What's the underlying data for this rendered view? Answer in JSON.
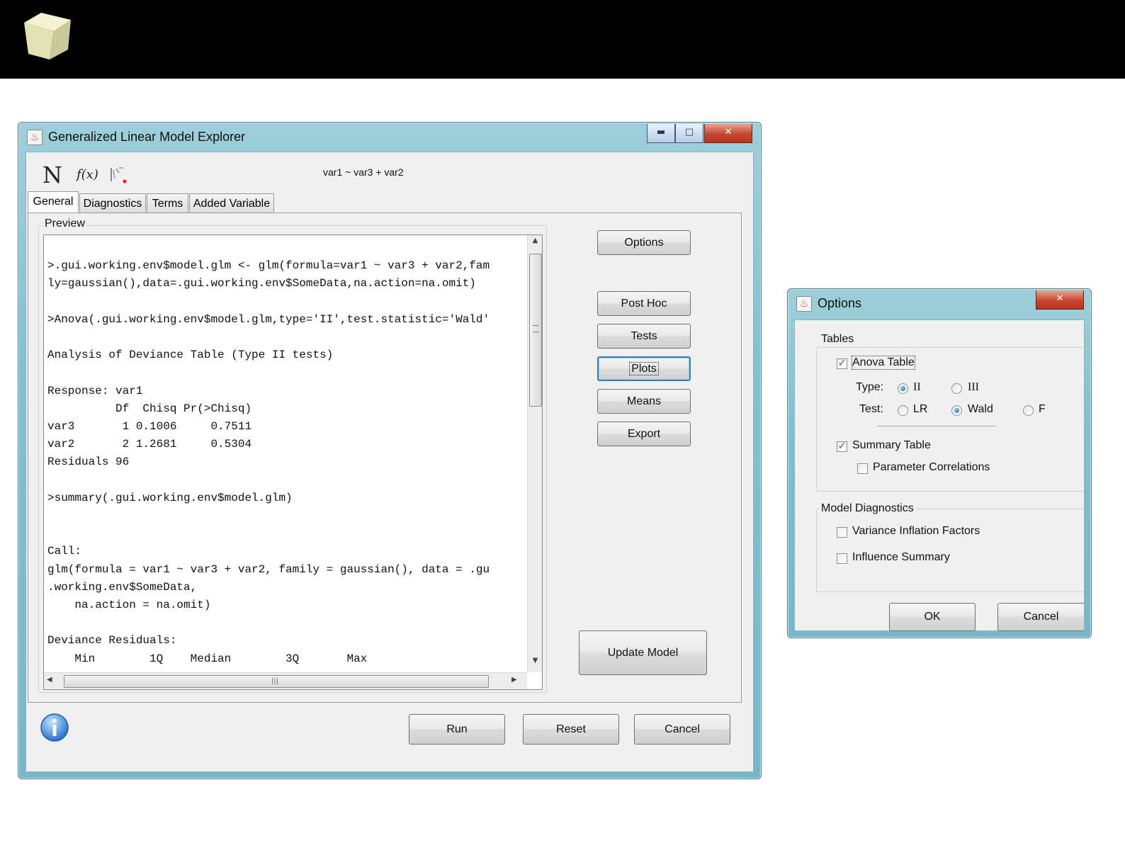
{
  "glm_window": {
    "title": "Generalized Linear Model Explorer",
    "toolbar": {
      "normal_icon": "N",
      "function_icon": "f(x)",
      "formula": "var1 ~ var3 + var2"
    },
    "tabs": [
      "General",
      "Diagnostics",
      "Terms",
      "Added Variable"
    ],
    "preview_label": "Preview",
    "preview_lines": [
      "",
      ">.gui.working.env$model.glm <- glm(formula=var1 ~ var3 + var2,fam",
      "ly=gaussian(),data=.gui.working.env$SomeData,na.action=na.omit)",
      "",
      ">Anova(.gui.working.env$model.glm,type='II',test.statistic='Wald'",
      "",
      "Analysis of Deviance Table (Type II tests)",
      "",
      "Response: var1",
      "          Df  Chisq Pr(>Chisq)",
      "var3       1 0.1006     0.7511",
      "var2       2 1.2681     0.5304",
      "Residuals 96",
      "",
      ">summary(.gui.working.env$model.glm)",
      "",
      "",
      "Call:",
      "glm(formula = var1 ~ var3 + var2, family = gaussian(), data = .gu",
      ".working.env$SomeData,",
      "    na.action = na.omit)",
      "",
      "Deviance Residuals:",
      "    Min        1Q    Median        3Q       Max"
    ],
    "side_buttons": {
      "options": "Options",
      "post_hoc": "Post Hoc",
      "tests": "Tests",
      "plots": "Plots",
      "means": "Means",
      "export": "Export",
      "update_model": "Update Model"
    },
    "bottom_buttons": {
      "run": "Run",
      "reset": "Reset",
      "cancel": "Cancel"
    }
  },
  "options_dialog": {
    "title": "Options",
    "tables_group": "Tables",
    "anova_table": {
      "label": "Anova Table",
      "checked": true
    },
    "type_label": "Type:",
    "type_options": [
      {
        "label": "II",
        "selected": true
      },
      {
        "label": "III",
        "selected": false
      }
    ],
    "test_label": "Test:",
    "test_options": [
      {
        "label": "LR",
        "selected": false
      },
      {
        "label": "Wald",
        "selected": true
      },
      {
        "label": "F",
        "selected": false
      }
    ],
    "summary_table": {
      "label": "Summary Table",
      "checked": true
    },
    "parameter_correlations": {
      "label": "Parameter Correlations",
      "checked": false
    },
    "diagnostics_group": "Model Diagnostics",
    "variance_inflation": {
      "label": "Variance Inflation Factors",
      "checked": false
    },
    "influence_summary": {
      "label": "Influence Summary",
      "checked": false
    },
    "ok": "OK",
    "cancel": "Cancel"
  }
}
